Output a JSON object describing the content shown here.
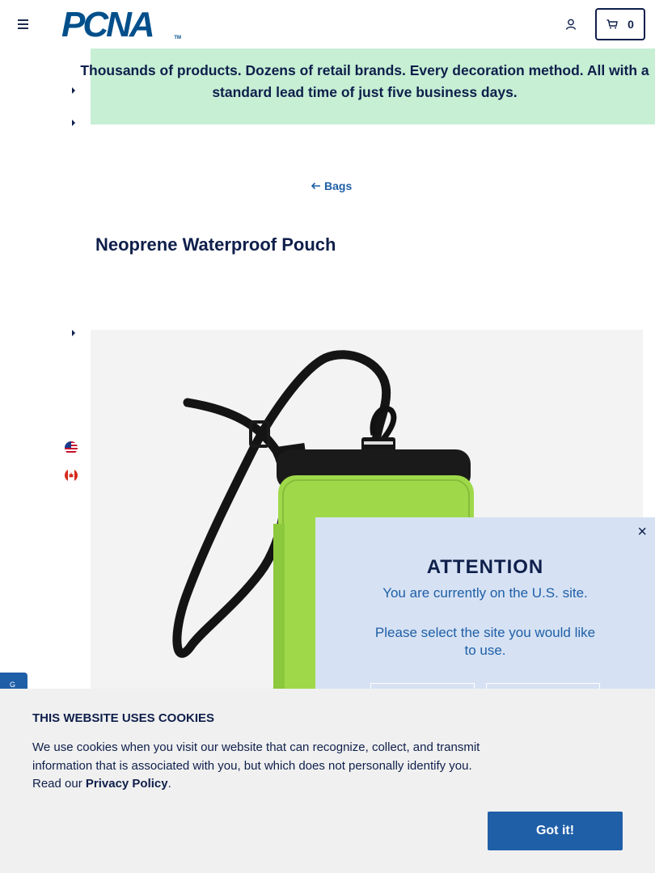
{
  "header": {
    "logo_text": "PCNA",
    "logo_tm": "TM",
    "cart_count": "0"
  },
  "banner": {
    "text": "Thousands of products. Dozens of retail brands. Every decoration method. All with a standard lead time of just five business days."
  },
  "breadcrumb": {
    "label": "Bags"
  },
  "product": {
    "title": "Neoprene Waterproof Pouch",
    "image_alt": "Neoprene Waterproof Pouch",
    "color": "#9fd94a"
  },
  "side_tab": {
    "label": "G"
  },
  "attention_modal": {
    "close_label": "×",
    "title": "ATTENTION",
    "line1": "You are currently on the U.S. site.",
    "line2": "Please select the site you would like to use."
  },
  "cookie_banner": {
    "title": "THIS WEBSITE USES COOKIES",
    "text_prefix": "We use cookies when you visit our website that can recognize, collect, and transmit information that is associated with you, but which does not personally identify you. Read our ",
    "privacy_link": "Privacy Policy",
    "text_suffix": ".",
    "accept_label": "Got it!"
  },
  "colors": {
    "navy": "#0f1f4b",
    "brand_blue": "#1f5fa8",
    "banner_green": "#c6efd4",
    "modal_bg": "#d6e2f3"
  }
}
